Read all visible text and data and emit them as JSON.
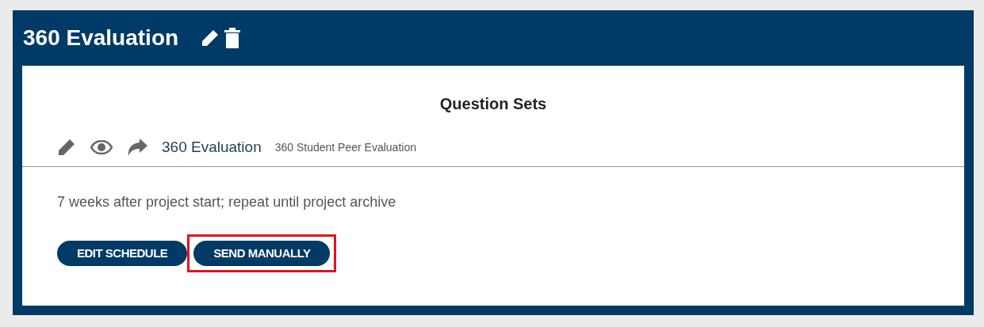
{
  "header": {
    "title": "360 Evaluation"
  },
  "section": {
    "title": "Question Sets",
    "question_set": {
      "name": "360 Evaluation",
      "description": "360 Student Peer Evaluation"
    }
  },
  "schedule": {
    "text": "7 weeks after project start; repeat until project archive"
  },
  "buttons": [
    {
      "label": "EDIT SCHEDULE",
      "highlighted": false
    },
    {
      "label": "SEND MANUALLY",
      "highlighted": true
    }
  ]
}
